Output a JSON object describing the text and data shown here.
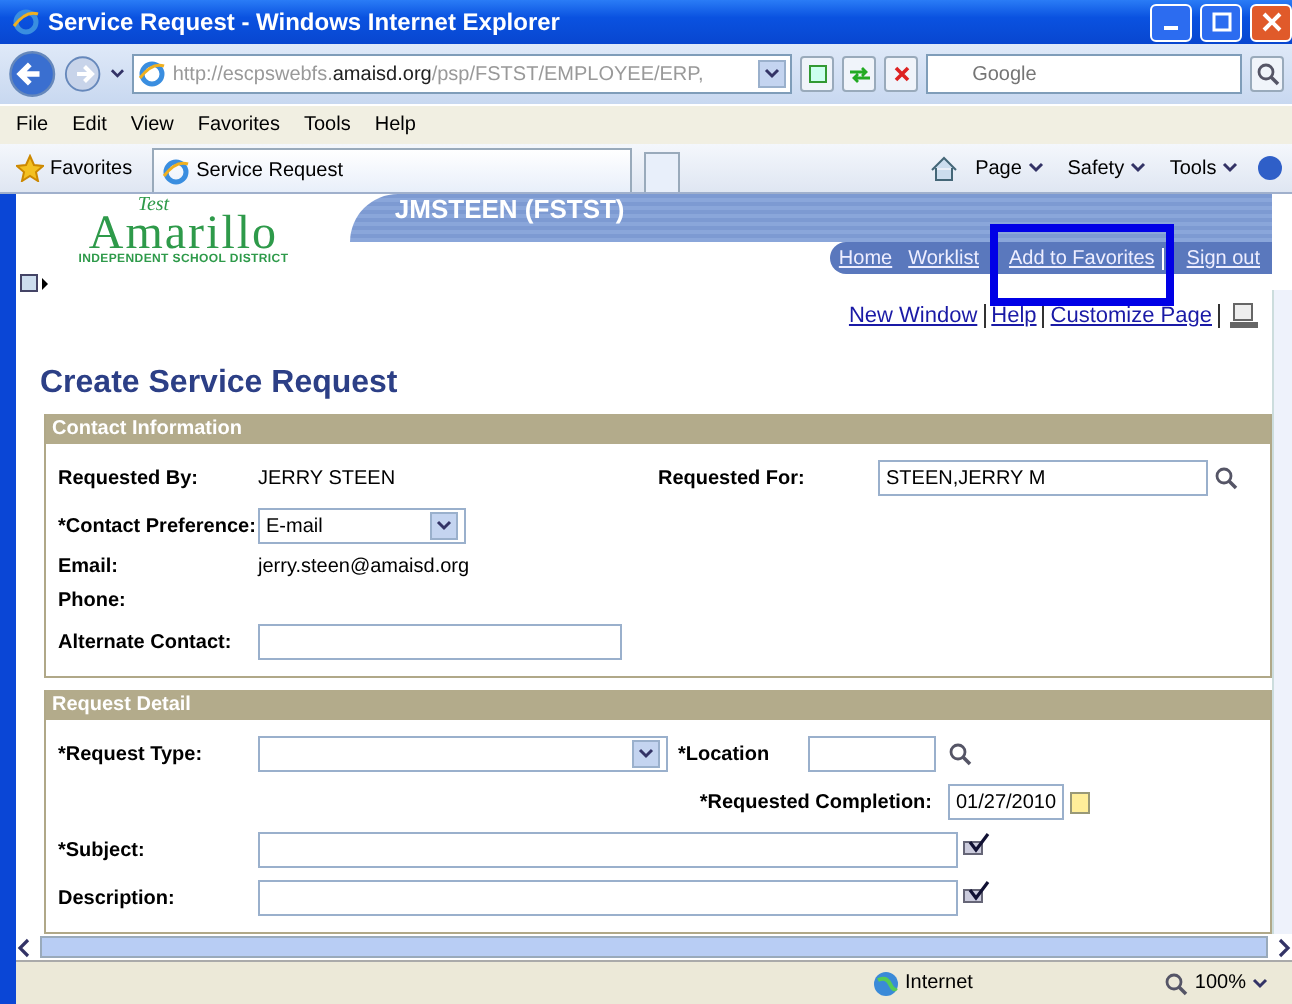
{
  "window": {
    "title": "Service Request - Windows Internet Explorer"
  },
  "address_bar": {
    "url": "http://escpswebfs.**amaisd.org**/psp/FSTST/EMPLOYEE/ERP,",
    "search_placeholder": "Google"
  },
  "menu": [
    "File",
    "Edit",
    "View",
    "Favorites",
    "Tools",
    "Help"
  ],
  "favorites_bar": {
    "favorites": "Favorites",
    "tab": "Service Request",
    "tools": [
      "Page",
      "Safety",
      "Tools"
    ]
  },
  "header": {
    "logo_top": "Test",
    "logo": "Amarillo",
    "logo_sub": "INDEPENDENT SCHOOL DISTRICT",
    "user": "JMSTEEN (FSTST)",
    "links": [
      {
        "label": "Home",
        "highlighted": false
      },
      {
        "label": "Worklist",
        "highlighted": false
      },
      {
        "label": "Add to Favorites",
        "highlighted": true
      },
      {
        "label": "Sign out",
        "highlighted": false
      }
    ]
  },
  "page_links": [
    "New Window",
    "Help",
    "Customize Page"
  ],
  "page_title": "Create Service Request",
  "contact": {
    "title": "Contact Information",
    "requested_by": {
      "label": "Requested By:",
      "value": "JERRY STEEN"
    },
    "requested_for": {
      "label": "Requested For:",
      "value": "STEEN,JERRY M"
    },
    "contact_preference": {
      "label": "*Contact Preference:",
      "value": "E-mail"
    },
    "email": {
      "label": "Email:",
      "value": "jerry.steen@amaisd.org"
    },
    "phone": {
      "label": "Phone:"
    },
    "alternate_contact": {
      "label": "Alternate Contact:"
    }
  },
  "detail": {
    "title": "Request Detail",
    "request_type": {
      "label": "*Request Type:"
    },
    "location": {
      "label": "*Location"
    },
    "requested_completion": {
      "label": "*Requested Completion:",
      "value": "01/27/2010"
    },
    "subject": {
      "label": "*Subject:"
    },
    "description": {
      "label": "Description:"
    }
  },
  "status_bar": {
    "zone": "Internet",
    "zoom": "100%"
  }
}
